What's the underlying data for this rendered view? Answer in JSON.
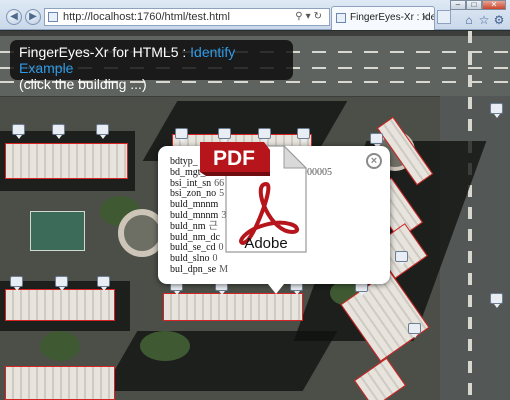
{
  "browser": {
    "address": "http://localhost:1760/html/test.html",
    "tab_title": "FingerEyes-Xr : Identify",
    "back_icon": "back-arrow-icon",
    "forward_icon": "forward-arrow-icon",
    "home_icon": "home-icon",
    "favorites_icon": "star-icon",
    "tools_icon": "gear-icon"
  },
  "overlay": {
    "title_prefix": "FingerEyes-Xr for HTML5 : ",
    "title_accent": "Identify Example",
    "subtitle": "(click the building ...)",
    "accent_color": "#2f9be8"
  },
  "popup": {
    "attributes": [
      {
        "key": "bdtyp_",
        "value": ""
      },
      {
        "key": "bd_mgt_sn",
        "value": ""
      },
      {
        "key": "bsi_int_sn",
        "value": "66"
      },
      {
        "key": "bsi_zon_no",
        "value": "5"
      },
      {
        "key": "buld_mnnm",
        "value": ""
      },
      {
        "key": "buld_mnnm",
        "value": "3"
      },
      {
        "key": "buld_nm",
        "value": "근"
      },
      {
        "key": "buld_nm_dc",
        "value": ""
      },
      {
        "key": "buld_se_cd",
        "value": "0"
      },
      {
        "key": "buld_slno",
        "value": "0"
      },
      {
        "key": "bul_dpn_se",
        "value": "M"
      }
    ],
    "bd_mgt_sn_tail": "000005",
    "close_label": "×"
  },
  "pdf_icon": {
    "badge": "PDF",
    "brand": "Adobe",
    "badge_color": "#b5151b"
  }
}
